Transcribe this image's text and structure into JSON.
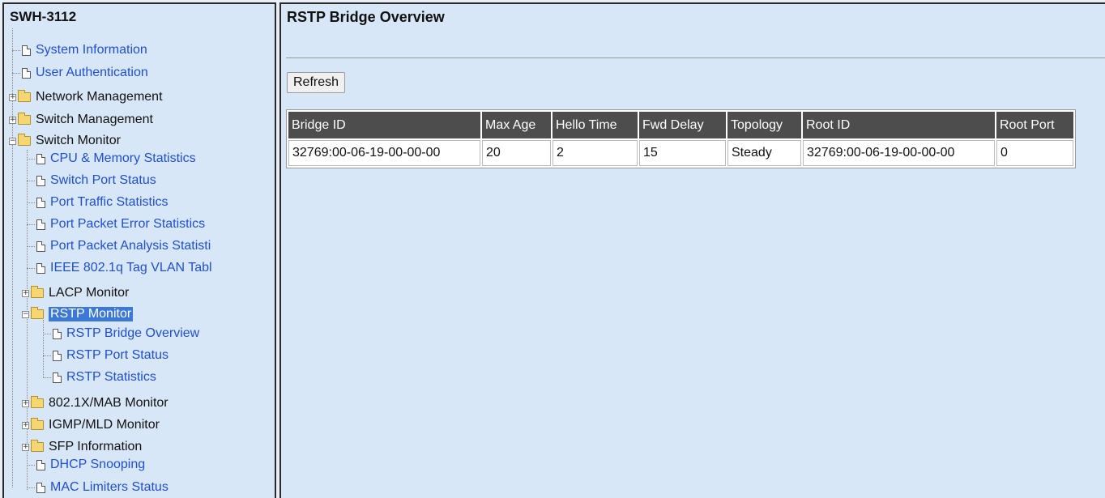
{
  "tree": {
    "device_title": "SWH-3112",
    "items": [
      {
        "label": "System Information",
        "kind": "link"
      },
      {
        "label": "User Authentication",
        "kind": "link"
      },
      {
        "label": "Network Management",
        "kind": "folder",
        "state": "collapsed"
      },
      {
        "label": "Switch Management",
        "kind": "folder",
        "state": "collapsed"
      },
      {
        "label": "Switch Monitor",
        "kind": "folder",
        "state": "expanded"
      },
      {
        "label": "CPU & Memory Statistics",
        "kind": "link"
      },
      {
        "label": "Switch Port Status",
        "kind": "link"
      },
      {
        "label": "Port Traffic Statistics",
        "kind": "link"
      },
      {
        "label": "Port Packet Error Statistics",
        "kind": "link"
      },
      {
        "label": "Port Packet Analysis Statisti",
        "kind": "link"
      },
      {
        "label": "IEEE 802.1q Tag VLAN Tabl",
        "kind": "link"
      },
      {
        "label": "LACP Monitor",
        "kind": "folder",
        "state": "collapsed"
      },
      {
        "label": "RSTP Monitor",
        "kind": "folder",
        "state": "expanded",
        "selected": true
      },
      {
        "label": "RSTP Bridge Overview",
        "kind": "link"
      },
      {
        "label": "RSTP Port Status",
        "kind": "link"
      },
      {
        "label": "RSTP Statistics",
        "kind": "link"
      },
      {
        "label": "802.1X/MAB Monitor",
        "kind": "folder",
        "state": "collapsed"
      },
      {
        "label": "IGMP/MLD Monitor",
        "kind": "folder",
        "state": "collapsed"
      },
      {
        "label": "SFP Information",
        "kind": "folder",
        "state": "collapsed"
      },
      {
        "label": "DHCP Snooping",
        "kind": "link"
      },
      {
        "label": "MAC Limiters Status",
        "kind": "link"
      }
    ]
  },
  "main": {
    "title": "RSTP Bridge Overview",
    "refresh_label": "Refresh",
    "table": {
      "headers": [
        "Bridge ID",
        "Max Age",
        "Hello Time",
        "Fwd Delay",
        "Topology",
        "Root ID",
        "Root Port"
      ],
      "rows": [
        [
          "32769:00-06-19-00-00-00",
          "20",
          "2",
          "15",
          "Steady",
          "32769:00-06-19-00-00-00",
          "0"
        ]
      ]
    }
  },
  "colors": {
    "panel_bg": "#d8e7f7",
    "link": "#1f4fd1",
    "header_bg": "#4d4d4d",
    "selected_bg": "#3c78d8"
  }
}
